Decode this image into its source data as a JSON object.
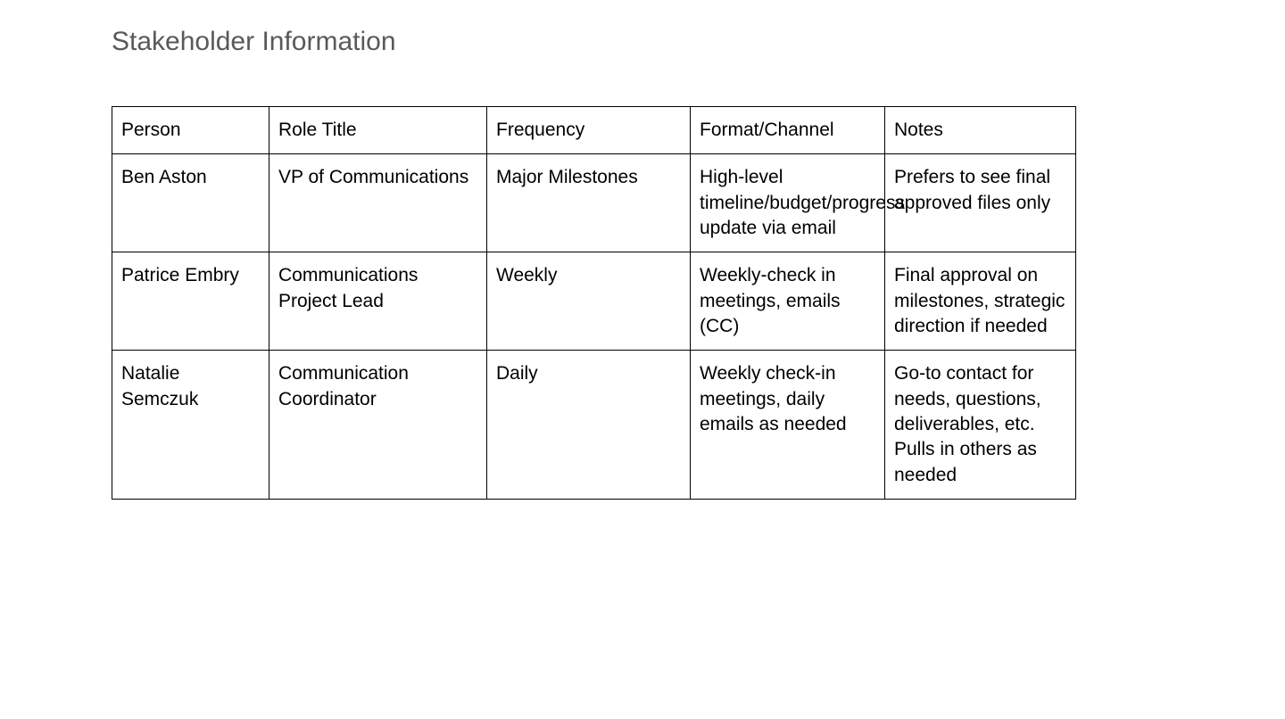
{
  "title": "Stakeholder Information",
  "table": {
    "headers": {
      "person": "Person",
      "role": "Role Title",
      "frequency": "Frequency",
      "format": "Format/Channel",
      "notes": "Notes"
    },
    "rows": [
      {
        "person": "Ben Aston",
        "role": "VP of Communications",
        "frequency": "Major Milestones",
        "format": "High-level timeline/budget/progress update via email",
        "notes": "Prefers to see final approved files only"
      },
      {
        "person": "Patrice Embry",
        "role": "Communications Project Lead",
        "frequency": "Weekly",
        "format": "Weekly-check in meetings, emails (CC)",
        "notes": "Final approval on milestones, strategic direction if needed"
      },
      {
        "person": "Natalie Semczuk",
        "role": "Communication Coordinator",
        "frequency": "Daily",
        "format": "Weekly check-in meetings, daily emails as needed",
        "notes": "Go-to contact for needs, questions, deliverables, etc. Pulls in others as needed"
      }
    ]
  }
}
